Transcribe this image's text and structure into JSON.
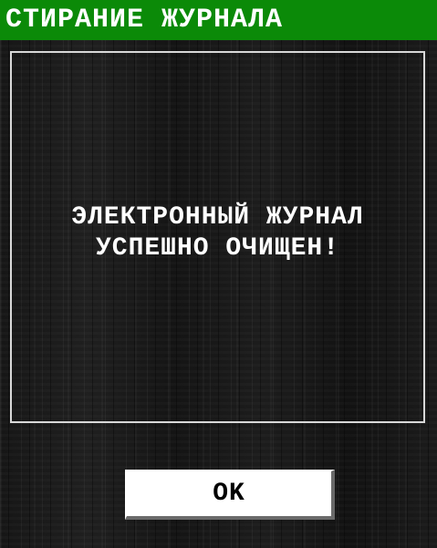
{
  "window": {
    "title": "СТИРАНИЕ ЖУРНАЛА"
  },
  "message": {
    "line1": "ЭЛЕКТРОННЫЙ ЖУРНАЛ",
    "line2": "УСПЕШНО ОЧИЩЕН!"
  },
  "buttons": {
    "ok_label": "OK"
  },
  "colors": {
    "title_bar": "#0b8a08",
    "text": "#ffffff",
    "button_bg": "#ffffff"
  }
}
